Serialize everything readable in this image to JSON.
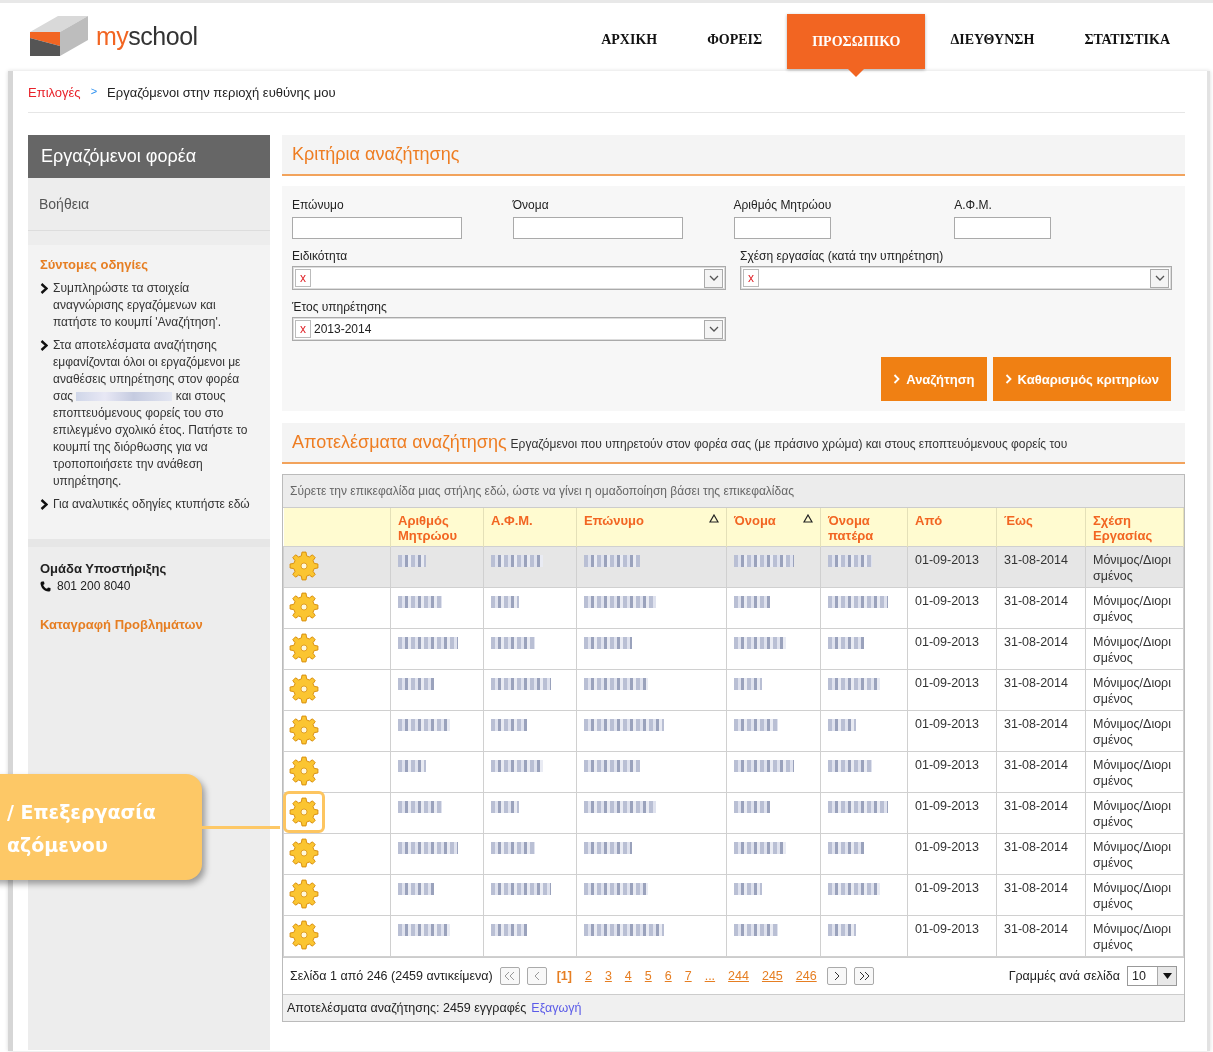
{
  "logo": {
    "accent": "my",
    "rest": "school"
  },
  "nav": [
    {
      "label": "ΑΡΧΙΚΗ",
      "selected": false
    },
    {
      "label": "ΦΟΡΕΙΣ",
      "selected": false
    },
    {
      "label": "ΠΡΟΣΩΠΙΚΟ",
      "selected": true
    },
    {
      "label": "ΔΙΕΥΘΥΝΣΗ",
      "selected": false
    },
    {
      "label": "ΣΤΑΤΙΣΤΙΚΑ",
      "selected": false
    }
  ],
  "breadcrumb": {
    "link": "Επιλογές",
    "separator": ">",
    "current": "Εργαζόμενοι στην περιοχή ευθύνης μου"
  },
  "sidebar": {
    "title": "Εργαζόμενοι φορέα",
    "help": "Βοήθεια",
    "guide_title": "Σύντομες οδηγίες",
    "instructions": [
      {
        "text": "Συμπληρώστε τα στοιχεία αναγνώρισης εργαζόμενων και πατήστε το κουμπί 'Αναζήτηση'."
      },
      {
        "text": "Στα αποτελέσματα αναζήτησης εμφανίζονται όλοι οι εργαζόμενοι με αναθέσεις υπηρέτησης στον φορέα σας",
        "redacted": true,
        "after": "και στους εποπτευόμενους φορείς του στο επιλεγμένο σχολικό έτος. Πατήστε το κουμπί της διόρθωσης για να τροποποιήσετε την ανάθεση υπηρέτησης."
      },
      {
        "text": "Για αναλυτικές οδηγίες κτυπήστε εδώ"
      }
    ],
    "support_title": "Ομάδα Υποστήριξης",
    "support_phone": "801 200 8040",
    "report_link": "Καταγραφή Προβλημάτων"
  },
  "criteria": {
    "title": "Κριτήρια αναζήτησης",
    "text_fields": [
      {
        "label": "Επώνυμο",
        "kind": "wide"
      },
      {
        "label": "Όνομα",
        "kind": "wide"
      },
      {
        "label": "Αριθμός Μητρώου",
        "kind": "narrow"
      },
      {
        "label": "Α.Φ.Μ.",
        "kind": "narrow"
      }
    ],
    "selects": [
      {
        "label": "Ειδικότητα",
        "clear": "x"
      },
      {
        "label": "Σχέση εργασίας (κατά την υπηρέτηση)",
        "clear": "x"
      },
      {
        "label": "Έτος υπηρέτησης",
        "clear": "x",
        "value": "2013-2014"
      }
    ],
    "buttons": [
      "Αναζήτηση",
      "Καθαρισμός κριτηρίων"
    ]
  },
  "results": {
    "title": "Αποτελέσματα αναζήτησης",
    "subtitle": "Εργαζόμενοι που υπηρετούν στον φορέα σας (με πράσινο χρώμα) και στους εποπτευόμενους φορείς του",
    "group_hint": "Σύρετε την επικεφαλίδα μιας στήλης εδώ, ώστε να γίνει η ομαδοποίηση βάσει της επικεφαλίδας",
    "columns": [
      {
        "label": "Αριθμός Μητρώου",
        "kind": "redacted",
        "sorted": false
      },
      {
        "label": "Α.Φ.Μ.",
        "kind": "redacted",
        "sorted": false
      },
      {
        "label": "Επώνυμο",
        "kind": "redacted",
        "sorted": true
      },
      {
        "label": "Όνομα",
        "kind": "redacted",
        "sorted": true
      },
      {
        "label": "Όνομα πατέρα",
        "kind": "redacted",
        "sorted": false
      },
      {
        "label": "Από",
        "kind": "text",
        "sorted": false
      },
      {
        "label": "Έως",
        "kind": "text",
        "sorted": false
      },
      {
        "label": "Σχέση Εργασίας",
        "kind": "text",
        "sorted": false
      }
    ],
    "rows": [
      {
        "selected": true,
        "highlighted": false,
        "cells": [
          "01-09-2013",
          "31-08-2014",
          "Μόνιμος/Διορισμένος"
        ]
      },
      {
        "selected": false,
        "highlighted": false,
        "cells": [
          "01-09-2013",
          "31-08-2014",
          "Μόνιμος/Διορισμένος"
        ]
      },
      {
        "selected": false,
        "highlighted": false,
        "cells": [
          "01-09-2013",
          "31-08-2014",
          "Μόνιμος/Διορισμένος"
        ]
      },
      {
        "selected": false,
        "highlighted": false,
        "cells": [
          "01-09-2013",
          "31-08-2014",
          "Μόνιμος/Διορισμένος"
        ]
      },
      {
        "selected": false,
        "highlighted": false,
        "cells": [
          "01-09-2013",
          "31-08-2014",
          "Μόνιμος/Διορισμένος"
        ]
      },
      {
        "selected": false,
        "highlighted": false,
        "cells": [
          "01-09-2013",
          "31-08-2014",
          "Μόνιμος/Διορισμένος"
        ]
      },
      {
        "selected": false,
        "highlighted": true,
        "cells": [
          "01-09-2013",
          "31-08-2014",
          "Μόνιμος/Διορισμένος"
        ]
      },
      {
        "selected": false,
        "highlighted": false,
        "cells": [
          "01-09-2013",
          "31-08-2014",
          "Μόνιμος/Διορισμένος"
        ]
      },
      {
        "selected": false,
        "highlighted": false,
        "cells": [
          "01-09-2013",
          "31-08-2014",
          "Μόνιμος/Διορισμένος"
        ]
      },
      {
        "selected": false,
        "highlighted": false,
        "cells": [
          "01-09-2013",
          "31-08-2014",
          "Μόνιμος/Διορισμένος"
        ]
      }
    ],
    "pager": {
      "summary": "Σελίδα 1 από 246 (2459 αντικείμενα)",
      "pages": [
        {
          "label": "[1]",
          "selected": true
        },
        {
          "label": "2",
          "selected": false
        },
        {
          "label": "3",
          "selected": false
        },
        {
          "label": "4",
          "selected": false
        },
        {
          "label": "5",
          "selected": false
        },
        {
          "label": "6",
          "selected": false
        },
        {
          "label": "7",
          "selected": false
        },
        {
          "label": "...",
          "selected": false
        },
        {
          "label": "244",
          "selected": false
        },
        {
          "label": "245",
          "selected": false
        },
        {
          "label": "246",
          "selected": false
        }
      ],
      "rows_label": "Γραμμές ανά σελίδα",
      "rows_value": "10"
    },
    "footer": {
      "text": "Αποτελέσματα αναζήτησης: 2459 εγγραφές",
      "link": "Εξαγωγή"
    }
  },
  "callout": {
    "lines": [
      "/ Επεξεργασία",
      "αζόμενου"
    ]
  }
}
